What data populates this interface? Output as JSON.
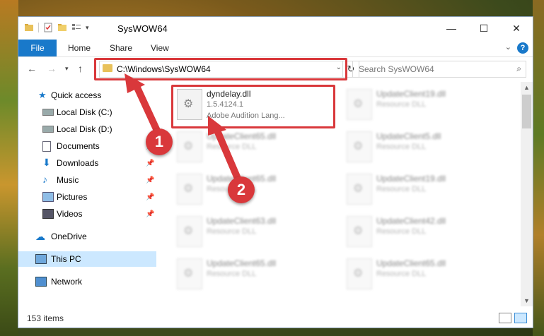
{
  "window": {
    "title": "SysWOW64"
  },
  "ribbon": {
    "file": "File",
    "tabs": [
      "Home",
      "Share",
      "View"
    ],
    "help": "?"
  },
  "address": {
    "path": "C:\\Windows\\SysWOW64"
  },
  "search": {
    "placeholder": "Search SysWOW64"
  },
  "sidebar": {
    "quick_access": "Quick access",
    "items": [
      {
        "label": "Local Disk (C:)",
        "icon": "drive-icon",
        "pinned": false
      },
      {
        "label": "Local Disk (D:)",
        "icon": "drive-icon",
        "pinned": false
      },
      {
        "label": "Documents",
        "icon": "documents-icon",
        "pinned": true
      },
      {
        "label": "Downloads",
        "icon": "downloads-icon",
        "pinned": true
      },
      {
        "label": "Music",
        "icon": "music-icon",
        "pinned": true
      },
      {
        "label": "Pictures",
        "icon": "pictures-icon",
        "pinned": true
      },
      {
        "label": "Videos",
        "icon": "videos-icon",
        "pinned": true
      }
    ],
    "onedrive": "OneDrive",
    "this_pc": "This PC",
    "network": "Network"
  },
  "files": {
    "highlighted": {
      "name": "dyndelay.dll",
      "version": "1.5.4124.1",
      "description": "Adobe Audition Lang..."
    },
    "blurred": [
      {
        "name": "UpdateClient19.dll",
        "type": "Resource DLL"
      },
      {
        "name": "UpdateClient65.dll",
        "type": "Resource DLL"
      },
      {
        "name": "UpdateClient5.dll",
        "type": "Resource DLL"
      },
      {
        "name": "UpdateClient65.dll",
        "type": "Resource DLL"
      },
      {
        "name": "UpdateClient19.dll",
        "type": "Resource DLL"
      },
      {
        "name": "UpdateClient63.dll",
        "type": "Resource DLL"
      },
      {
        "name": "UpdateClient42.dll",
        "type": "Resource DLL"
      },
      {
        "name": "UpdateClient65.dll",
        "type": "Resource DLL"
      },
      {
        "name": "UpdateClient65.dll",
        "type": "Resource DLL"
      }
    ]
  },
  "status": {
    "items": "153 items"
  },
  "annotations": {
    "step1": "1",
    "step2": "2"
  },
  "colors": {
    "accent": "#1979ca",
    "highlight": "#d9383b",
    "selection": "#cce8ff"
  }
}
